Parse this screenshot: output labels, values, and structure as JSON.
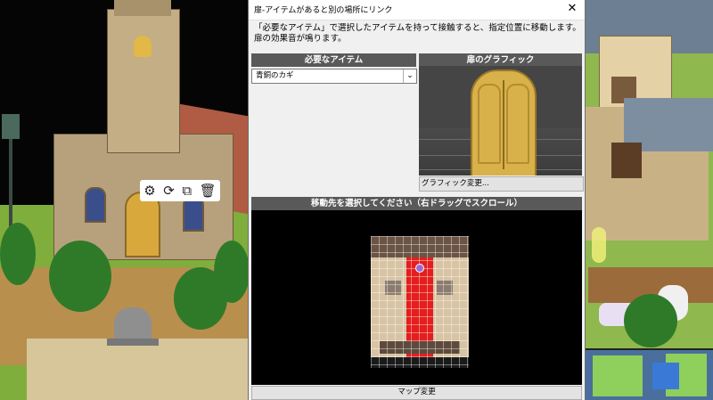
{
  "dialog": {
    "title": "扉-アイテムがあると別の場所にリンク",
    "close_glyph": "✕",
    "description_line1": "「必要なアイテム」で選択したアイテムを持って接触すると、指定位置に移動します。",
    "description_line2": "扉の効果音が鳴ります。"
  },
  "required_item": {
    "header": "必要なアイテム",
    "selected": "青銅のカギ",
    "arrow_glyph": "⌄"
  },
  "graphic": {
    "header": "扉のグラフィック",
    "change_button": "グラフィック変更..."
  },
  "destination": {
    "header": "移動先を選択してください（右ドラッグでスクロール）",
    "map_change_button": "マップ変更"
  },
  "toolbar": {
    "settings_icon": "⚙",
    "rotate_icon": "⟳",
    "copy_icon": "⧉",
    "delete_icon": "🗑"
  },
  "colors": {
    "dialog_bg": "#f0f0f0",
    "section_header": "#595959",
    "destination_bg": "#000000",
    "selected_path": "#e41e1e",
    "marker": "#9a6bd6"
  }
}
